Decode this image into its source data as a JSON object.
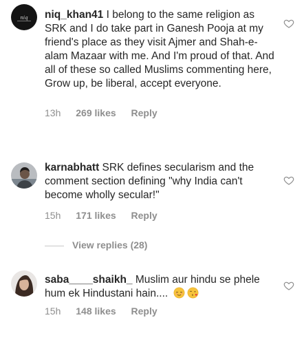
{
  "comments": [
    {
      "username": "niq_khan41",
      "text": " I belong to the same religion as SRK and I do take part in Ganesh Pooja at my friend's place as they visit Ajmer and Shah-e-alam Mazaar with me. And I'm proud of that. And all of these so called Muslims commenting here, Grow up, be liberal, accept everyone.",
      "time": "13h",
      "likes": "269 likes",
      "reply": "Reply"
    },
    {
      "username": "karnabhatt",
      "text": " SRK defines secularism and the comment section defining \"why India can't become wholly secular!\"",
      "time": "15h",
      "likes": "171 likes",
      "reply": "Reply",
      "view_replies": "View replies (28)"
    },
    {
      "username": "saba____shaikh_",
      "text": " Muslim aur hindu se phele hum ek Hindustani hain....",
      "emojis": [
        "relieved-face-emoji",
        "face-blowing-kiss-emoji"
      ],
      "time": "15h",
      "likes": "148 likes",
      "reply": "Reply"
    }
  ]
}
